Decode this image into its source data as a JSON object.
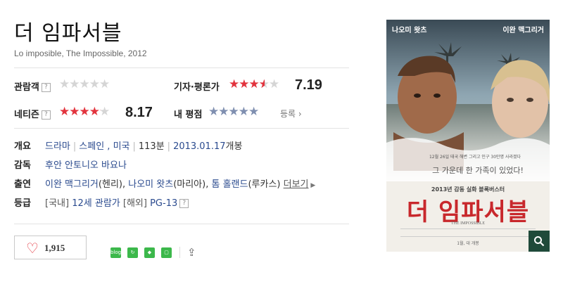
{
  "movie": {
    "title": "더 임파서블",
    "subtitle": "Lo imposible, The Impossible, 2012"
  },
  "ratings": {
    "audience_label": "관람객",
    "audience_stars": 0,
    "critic_label": "기자·평론가",
    "critic_stars": 3.6,
    "critic_score": "7.19",
    "netizen_label": "네티즌",
    "netizen_stars": 4.1,
    "netizen_score": "8.17",
    "my_label": "내 평점",
    "my_stars": 0,
    "register_label": "등록",
    "help_glyph": "?"
  },
  "info": {
    "overview_label": "개요",
    "genre": "드라마",
    "country1": "스페인",
    "country2": "미국",
    "runtime": "113분",
    "release": "2013.01.17",
    "release_suffix": "개봉",
    "director_label": "감독",
    "director": "후안 안토니오 바요나",
    "cast_label": "출연",
    "cast1": "이완 맥그리거",
    "cast1_role": "(헨리)",
    "cast2": "나오미 왓츠",
    "cast2_role": "(마리아)",
    "cast3": "톰 홀랜드",
    "cast3_role": "(루카스)",
    "more_label": "더보기",
    "grade_label": "등급",
    "grade_domestic": "[국내]",
    "grade_domestic_value": "12세 관람가",
    "grade_foreign": "[해외]",
    "grade_foreign_value": "PG-13"
  },
  "like": {
    "count": "1,915"
  },
  "share": {
    "blog_label": "blog"
  },
  "poster": {
    "actor_left": "나오미 왓츠",
    "actor_right": "이완 맥그리거",
    "tagline_small": "12월 26일 태국 해변 그리고 인구 30만명 사라졌다",
    "tagline": "그 가운데 한 가족이 있었다!",
    "kicker": "2013년 감동 실화 블록버스터",
    "title": "더 임파서블",
    "title_en": "THE IMPOSSIBLE",
    "release": "1월, 대 개봉",
    "colors": {
      "title_red": "#c8282c",
      "sky": "#8fa6b2",
      "sea": "#5b6a64"
    }
  }
}
